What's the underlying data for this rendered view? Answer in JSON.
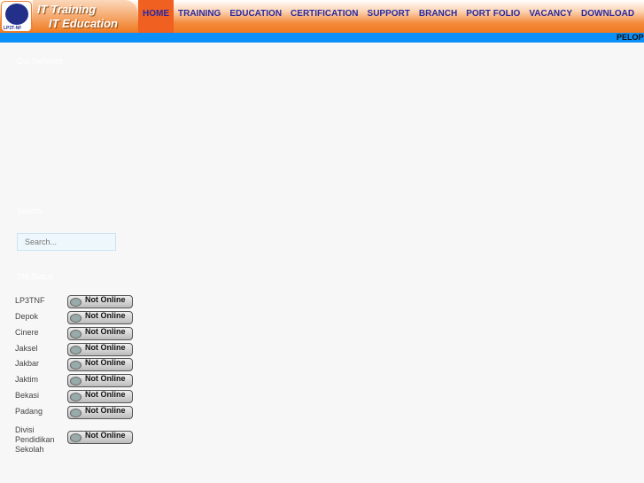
{
  "logo": {
    "text": "LP3T-NF"
  },
  "brand": {
    "line1": "IT Training",
    "line2": "IT Education"
  },
  "nav": [
    "HOME",
    "TRAINING",
    "EDUCATION",
    "CERTIFICATION",
    "SUPPORT",
    "BRANCH",
    "PORT FOLIO",
    "VACANCY",
    "DOWNLOAD"
  ],
  "marquee": "PELOPO",
  "sidebar": {
    "services_title": "Our Services",
    "search_title": "Search",
    "search_placeholder": "Search...",
    "ym_title": "YM Status",
    "ym": [
      {
        "name": "LP3TNF",
        "status": "Not Online"
      },
      {
        "name": "Depok",
        "status": "Not Online"
      },
      {
        "name": "Cinere",
        "status": "Not Online"
      },
      {
        "name": "Jaksel",
        "status": "Not Online"
      },
      {
        "name": "Jakbar",
        "status": "Not Online"
      },
      {
        "name": "Jaktim",
        "status": "Not Online"
      },
      {
        "name": "Bekasi",
        "status": "Not Online"
      },
      {
        "name": "Padang",
        "status": "Not Online"
      },
      {
        "name": "Divisi Pendidikan Sekolah",
        "status": "Not Online"
      }
    ]
  }
}
